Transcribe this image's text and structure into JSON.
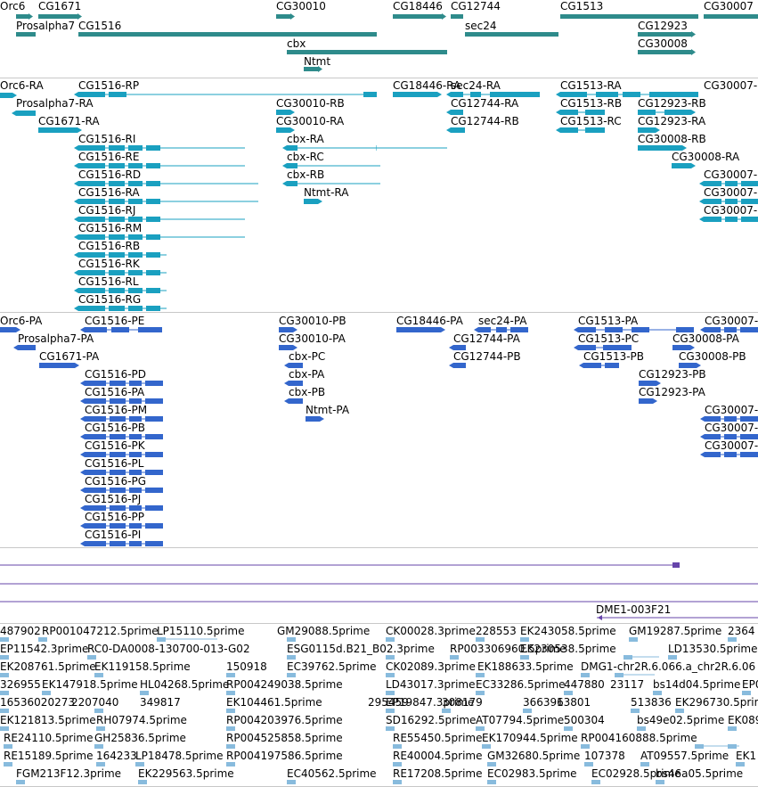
{
  "colors": {
    "genes": "#2e8b8b",
    "transcripts": "#1aa0c0",
    "proteins": "#3366cc",
    "alignments": "#6644aa",
    "ests": "#88bbdd",
    "separator": "#c8c8c8"
  },
  "tracks": [
    {
      "name": "genes",
      "labels": [
        "Orc6",
        "CG1671",
        "Prosalpha7",
        "CG1516",
        "CG30010",
        "cbx",
        "Ntmt",
        "CG18446",
        "CG12744",
        "sec24",
        "CG1513",
        "CG12923",
        "CG30008",
        "CG30007"
      ]
    },
    {
      "name": "transcripts",
      "labels": [
        "Orc6-RA",
        "CG1516-RP",
        "Prosalpha7-RA",
        "CG1671-RA",
        "CG30010-RB",
        "CG30010-RA",
        "CG18446-RA",
        "sec24-RA",
        "CG12744-RA",
        "CG12744-RB",
        "CG1513-RA",
        "CG1513-RB",
        "CG1513-RC",
        "CG12923-RB",
        "CG12923-RA",
        "CG30008-RB",
        "CG30008-RA",
        "CG30007-",
        "CG1516-RI",
        "CG1516-RE",
        "CG1516-RD",
        "CG1516-RA",
        "CG1516-RJ",
        "CG1516-RM",
        "CG1516-RB",
        "CG1516-RK",
        "CG1516-RL",
        "CG1516-RG",
        "cbx-RA",
        "cbx-RC",
        "cbx-RB",
        "Ntmt-RA",
        "CG30007-",
        "CG30007-",
        "CG30007-"
      ]
    },
    {
      "name": "proteins",
      "labels": [
        "Orc6-PA",
        "CG1516-PE",
        "Prosalpha7-PA",
        "CG1671-PA",
        "CG30010-PB",
        "CG30010-PA",
        "cbx-PC",
        "cbx-PA",
        "cbx-PB",
        "Ntmt-PA",
        "CG18446-PA",
        "sec24-PA",
        "CG12744-PA",
        "CG12744-PB",
        "CG1513-PA",
        "CG1513-PC",
        "CG1513-PB",
        "CG30008-PA",
        "CG30008-PB",
        "CG12923-PB",
        "CG12923-PA",
        "CG30007-",
        "CG30007-",
        "CG30007-",
        "CG30007-",
        "CG1516-PD",
        "CG1516-PA",
        "CG1516-PM",
        "CG1516-PB",
        "CG1516-PK",
        "CG1516-PL",
        "CG1516-PG",
        "CG1516-PJ",
        "CG1516-PP",
        "CG1516-PI"
      ]
    },
    {
      "name": "alignments",
      "labels": [
        "DME1-003F21"
      ]
    },
    {
      "name": "ests",
      "labels": [
        "487902",
        "RP001047212.5prime",
        "LP15110.5prime",
        "GM29088.5prime",
        "CK00028.3prime",
        "228553",
        "EK243058.5prime",
        "GM19287.5prime",
        "2364",
        "EP11542.3prime",
        "RC0-DA0008-130700-013-G02",
        "ESG0115d.B21_B02.3prime",
        "RP003306960.5prime",
        "EK230538.5prime",
        "LD13530.5prime",
        "EK208761.5prime",
        "EK119158.5prime",
        "150918",
        "EC39762.5prime",
        "CK02089.3prime",
        "EK188633.5prime",
        "DMG1-chr2R.6.066.a_chr2R.6.06",
        "326955",
        "EK147918.5prime",
        "HL04268.5prime",
        "RP004249038.5prime",
        "LD43017.3prime",
        "EC33286.5prime",
        "447880",
        "23117",
        "bs14d04.5prime",
        "EP0",
        "EK104461.5prime",
        "EP19847.3prime",
        "308179",
        "366396",
        "13801",
        "513836",
        "EK296730.5prime",
        "16536020273",
        "2207040",
        "349817",
        "295459",
        "EK121813.5prime",
        "RH07974.5prime",
        "RP004203976.5prime",
        "SD16292.5prime",
        "AT07794.5prime",
        "500304",
        "bs49e02.5prime",
        "EK089",
        "RE24110.5prime",
        "GH25836.5prime",
        "RP004525858.5prime",
        "RE55450.5prime",
        "EK170944.5prime",
        "RP004160888.5prime",
        "RE15189.5prime",
        "164233",
        "LP18478.5prime",
        "RP004197586.5prime",
        "RE40004.5prime",
        "GM32680.5prime",
        "107378",
        "AT09557.5prime",
        "EK1",
        "FGM213F12.3prime",
        "EK229563.5prime",
        "EC40562.5prime",
        "RE17208.5prime",
        "EC02983.5prime",
        "EC02928.5prime",
        "bs46a05.5prime"
      ]
    }
  ]
}
